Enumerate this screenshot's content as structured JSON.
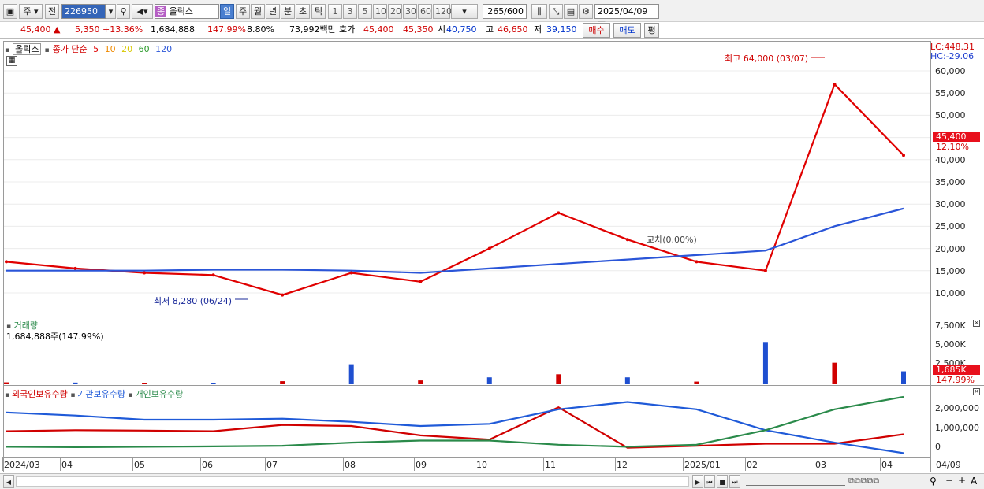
{
  "toolbar": {
    "period_main": "주",
    "prev_label": "전",
    "stock_code": "226950",
    "stock_badge": "종",
    "stock_name": "올릭스",
    "periods": [
      "일",
      "주",
      "월",
      "년",
      "분",
      "초",
      "틱"
    ],
    "active_period": "일",
    "intervals": [
      "1",
      "3",
      "5",
      "10",
      "20",
      "30",
      "60",
      "120"
    ],
    "count_value": "265",
    "count_total": "/600",
    "date": "2025/04/09"
  },
  "quote": {
    "price": "45,400",
    "change_arrow": "▲",
    "change": "5,350",
    "change_pct": "+13.36%",
    "volume": "1,684,888",
    "volume_ratio": "147.99%",
    "turnover": "8.80%",
    "amount": "73,992백만",
    "bid_label": "호가",
    "ask": "45,400",
    "bid": "45,350",
    "open_label": "시",
    "open": "40,750",
    "high_label": "고",
    "high": "46,650",
    "low_label": "저",
    "low": "39,150",
    "buy_label": "매수",
    "sell_label": "매도",
    "eval_label": "평"
  },
  "price_panel": {
    "legend_name": "올릭스",
    "legend_ma_title": "종가 단순",
    "ma_periods": [
      "5",
      "10",
      "20",
      "60",
      "120"
    ],
    "ma_colors": [
      "#e00000",
      "#f08a00",
      "#f4e400",
      "#2a9a2a",
      "#2a55d8"
    ],
    "lc_label": "LC:448.31",
    "hc_label": "HC:-29.06",
    "max_label": "최고 64,000 (03/07)",
    "min_label": "최저 8,280 (06/24)",
    "price_badge": "45,400",
    "pct_badge": "12.10%",
    "cross_label": "교차(0.00%)",
    "y_ticks": [
      "60,000",
      "55,000",
      "50,000",
      "45,000",
      "40,000",
      "35,000",
      "30,000",
      "25,000",
      "20,000",
      "15,000",
      "10,000"
    ]
  },
  "volume_panel": {
    "title": "거래량",
    "value": "1,684,888주(147.99%)",
    "y_ticks": [
      "7,500K",
      "5,000K",
      "2,500K"
    ],
    "badge": "1,685K",
    "badge_pct": "147.99%"
  },
  "holdings_panel": {
    "legend": [
      "외국인보유수량",
      "기관보유수량",
      "개인보유수량"
    ],
    "legend_colors": [
      "#d00000",
      "#1f5ad8",
      "#2a8a4a"
    ],
    "y_ticks": [
      "2,000,000",
      "1,000,000",
      "0"
    ]
  },
  "x_axis": [
    "2024/03",
    "04",
    "05",
    "06",
    "07",
    "08",
    "09",
    "10",
    "11",
    "12",
    "2025/01",
    "02",
    "03",
    "04",
    "04/09"
  ],
  "chart_data": [
    {
      "type": "line",
      "title": "",
      "ylabel": "",
      "ylim": [
        5000,
        65000
      ],
      "x": [
        "2024/03",
        "04",
        "05",
        "06",
        "07",
        "08",
        "09",
        "10",
        "11",
        "12",
        "2025/01",
        "02",
        "03",
        "04"
      ],
      "series": [
        {
          "name": "종가",
          "values": [
            17000,
            15500,
            14500,
            14000,
            9500,
            14500,
            12500,
            20000,
            28000,
            22000,
            17000,
            15000,
            57000,
            41000
          ]
        },
        {
          "name": "120",
          "values": [
            15000,
            15000,
            15000,
            15200,
            15200,
            15000,
            14500,
            15500,
            16500,
            17500,
            18500,
            19500,
            25000,
            29000
          ]
        }
      ],
      "annotations": [
        "최고 64,000 (03/07)",
        "최저 8,280 (06/24)"
      ]
    },
    {
      "type": "bar",
      "title": "",
      "ylim": [
        0,
        8500
      ],
      "x": [
        "2024/03",
        "04",
        "05",
        "06",
        "07",
        "08",
        "09",
        "10",
        "11",
        "12",
        "2025/01",
        "02",
        "03",
        "04"
      ],
      "series": [
        {
          "name": "거래량",
          "values": [
            250,
            220,
            200,
            180,
            400,
            2600,
            500,
            900,
            1300,
            900,
            350,
            5500,
            2800,
            1685
          ]
        }
      ]
    },
    {
      "type": "line",
      "title": "",
      "ylim": [
        -300000,
        2800000
      ],
      "x": [
        "2024/03",
        "04",
        "05",
        "06",
        "07",
        "08",
        "09",
        "10",
        "11",
        "12",
        "2025/01",
        "02",
        "03",
        "04"
      ],
      "series": [
        {
          "name": "외국인보유수량",
          "values": [
            850000,
            900000,
            880000,
            850000,
            1150000,
            1100000,
            650000,
            450000,
            2000000,
            50000,
            150000,
            250000,
            250000,
            700000
          ]
        },
        {
          "name": "기관보유수량",
          "values": [
            1750000,
            1600000,
            1400000,
            1400000,
            1450000,
            1300000,
            1100000,
            1200000,
            1900000,
            2250000,
            1900000,
            900000,
            300000,
            -200000
          ]
        },
        {
          "name": "개인보유수량",
          "values": [
            100000,
            80000,
            100000,
            120000,
            150000,
            300000,
            400000,
            400000,
            200000,
            100000,
            200000,
            900000,
            1900000,
            2500000
          ]
        }
      ]
    }
  ]
}
